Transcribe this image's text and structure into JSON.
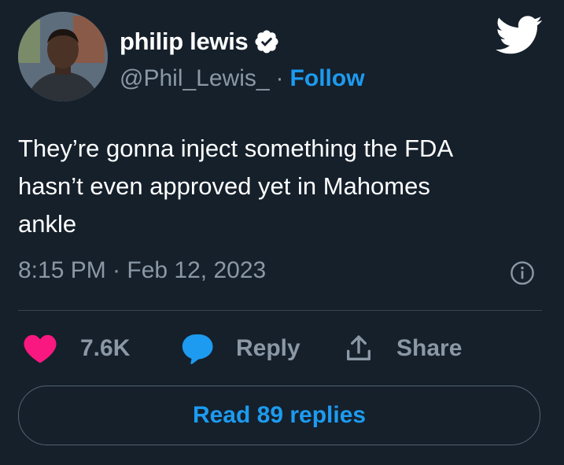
{
  "author": {
    "display_name": "philip lewis",
    "handle": "@Phil_Lewis_",
    "separator": "·",
    "follow_label": "Follow",
    "verified": true
  },
  "tweet": {
    "text_lines": [
      "They’re gonna inject something the FDA",
      "hasn’t even approved yet in Mahomes",
      "ankle"
    ],
    "timestamp": "8:15 PM · Feb 12, 2023"
  },
  "actions": {
    "like_count": "7.6K",
    "reply_label": "Reply",
    "share_label": "Share"
  },
  "read_replies_label": "Read 89 replies",
  "icons": {
    "brand": "twitter-bird-icon",
    "verified": "verified-badge-icon",
    "info": "info-icon",
    "like": "heart-icon",
    "reply": "speech-bubble-icon",
    "share": "share-icon"
  },
  "colors": {
    "background": "#15202b",
    "accent": "#1d9bf0",
    "like": "#f91880",
    "muted_text": "#8b98a5"
  }
}
